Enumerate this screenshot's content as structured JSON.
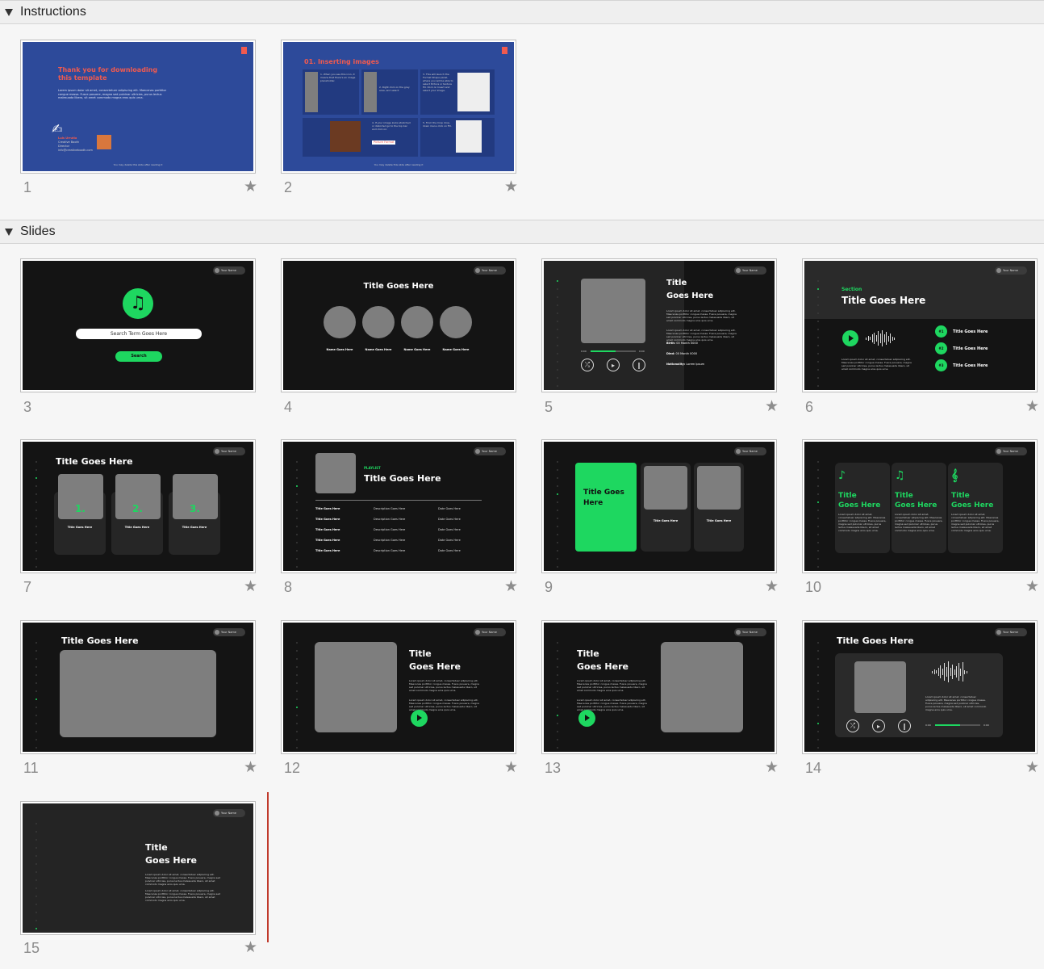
{
  "sections": {
    "instructions": {
      "label": "Instructions"
    },
    "slides": {
      "label": "Slides"
    }
  },
  "common": {
    "your_name": "Your Name",
    "lorem": "Lorem ipsum dolor sit amet, consectetuer adipiscing elit. Maecenas porttitor congue massa. Fusce posuere, magna sed pulvinar ultricies, purus lectus malesuada libero, sit amet commodo magna eros quis urna."
  },
  "thumbs": [
    {
      "num": "1",
      "starred": false
    },
    {
      "num": "2",
      "starred": false
    },
    {
      "num": "3",
      "starred": false
    },
    {
      "num": "4",
      "starred": false
    },
    {
      "num": "5",
      "starred": false
    },
    {
      "num": "6",
      "starred": false
    },
    {
      "num": "7",
      "starred": false
    },
    {
      "num": "8",
      "starred": false
    },
    {
      "num": "9",
      "starred": false
    },
    {
      "num": "10",
      "starred": false
    },
    {
      "num": "11",
      "starred": false
    },
    {
      "num": "12",
      "starred": false
    },
    {
      "num": "13",
      "starred": false
    },
    {
      "num": "14",
      "starred": false
    },
    {
      "num": "15",
      "starred": false
    }
  ],
  "s1": {
    "title": "Thank you for downloading this template",
    "name": "Luis Urrutia",
    "role1": "Creative Booth",
    "role2": "Director",
    "email": "info@creativebooth.com",
    "footer": "You may delete this slide after reading it"
  },
  "s2": {
    "title": "01. Inserting images",
    "step1": "1. When you see this icon, it means that there's an image placeholder.",
    "step2": "2. Right click on the gray area, and select:",
    "step3": "3. This will launch the Format Shape panel, where you will be able to select Picture or texture fill. Click on Insert and select your image.",
    "step4": "4. If your image looks stretched or distorted go to the top bar and click on:",
    "step5": "5. From the Crop drop-down menu click on Fill.",
    "fill_btn": "Format Shape...",
    "crop_btn": "Picture Format",
    "footer": "You may delete this slide after reading it"
  },
  "s3": {
    "search_placeholder": "Search Term Goes Here",
    "search_btn": "Search"
  },
  "s4": {
    "title": "Title Goes Here",
    "names": [
      "Name Goes Here",
      "Name Goes Here",
      "Name Goes Here",
      "Name Goes Here"
    ]
  },
  "s5": {
    "title1": "Title",
    "title2": "Goes Here",
    "birth_l": "Birth:",
    "birth_v": "00 Month 0000",
    "died_l": "Died:",
    "died_v": "00 Month 0000",
    "nat_l": "Nationality:",
    "nat_v": "Lorem Ipsum",
    "t_start": "0:00",
    "t_end": "0:00"
  },
  "s6": {
    "section": "Section",
    "title": "Title Goes Here",
    "items": [
      {
        "n": "#1",
        "t": "Title Goes Here"
      },
      {
        "n": "#2",
        "t": "Title Goes Here"
      },
      {
        "n": "#3",
        "t": "Title Goes Here"
      }
    ]
  },
  "s7": {
    "title": "Title Goes Here",
    "cards": [
      {
        "n": "1.",
        "t": "Title Goes Here"
      },
      {
        "n": "2.",
        "t": "Title Goes Here"
      },
      {
        "n": "3.",
        "t": "Title Goes Here"
      }
    ]
  },
  "s8": {
    "kicker": "PLAYLIST",
    "title": "Title Goes Here",
    "rows": [
      [
        "Title Goes Here",
        "Description Goes Here",
        "Date Goes Here"
      ],
      [
        "Title Goes Here",
        "Description Goes Here",
        "Date Goes Here"
      ],
      [
        "Title Goes Here",
        "Description Goes Here",
        "Date Goes Here"
      ],
      [
        "Title Goes Here",
        "Description Goes Here",
        "Date Goes Here"
      ],
      [
        "Title Goes Here",
        "Description Goes Here",
        "Date Goes Here"
      ]
    ]
  },
  "s9": {
    "title1": "Title Goes",
    "title2": "Here",
    "cards": [
      "Title Goes Here",
      "Title Goes Here"
    ]
  },
  "s10": {
    "cards": [
      {
        "icon": "♪",
        "t1": "Title",
        "t2": "Goes Here"
      },
      {
        "icon": "♫",
        "t1": "Title",
        "t2": "Goes Here"
      },
      {
        "icon": "𝄞",
        "t1": "Title",
        "t2": "Goes Here"
      }
    ]
  },
  "s11": {
    "title": "Title Goes Here"
  },
  "s12": {
    "title1": "Title",
    "title2": "Goes Here"
  },
  "s13": {
    "title1": "Title",
    "title2": "Goes Here"
  },
  "s14": {
    "title": "Title Goes Here",
    "t_start": "0:00",
    "t_end": "0:00"
  },
  "s15": {
    "title1": "Title",
    "title2": "Goes Here"
  }
}
